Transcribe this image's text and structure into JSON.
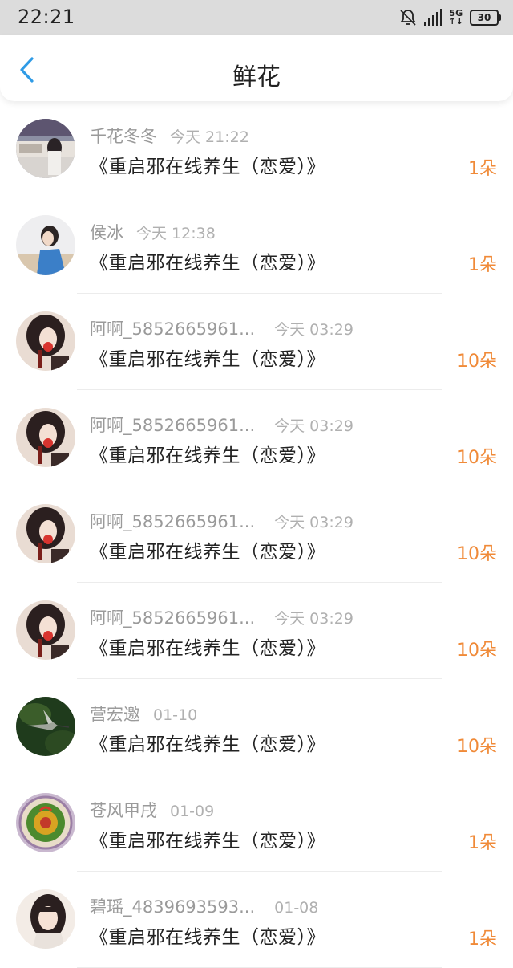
{
  "status_bar": {
    "time": "22:21",
    "network": "5G",
    "battery": "30"
  },
  "header": {
    "title": "鲜花",
    "back_icon": "chevron-left-icon"
  },
  "colors": {
    "accent": "#2f9be6",
    "count": "#f08a38"
  },
  "items": [
    {
      "name": "千花冬冬",
      "date": "今天 21:22",
      "book": "《重启邪在线养生（恋爱）》",
      "count": "1朵"
    },
    {
      "name": "侯冰",
      "date": "今天 12:38",
      "book": "《重启邪在线养生（恋爱）》",
      "count": "1朵"
    },
    {
      "name": "阿啊_5852665961...",
      "date": "今天 03:29",
      "book": "《重启邪在线养生（恋爱）》",
      "count": "10朵"
    },
    {
      "name": "阿啊_5852665961...",
      "date": "今天 03:29",
      "book": "《重启邪在线养生（恋爱）》",
      "count": "10朵"
    },
    {
      "name": "阿啊_5852665961...",
      "date": "今天 03:29",
      "book": "《重启邪在线养生（恋爱）》",
      "count": "10朵"
    },
    {
      "name": "阿啊_5852665961...",
      "date": "今天 03:29",
      "book": "《重启邪在线养生（恋爱）》",
      "count": "10朵"
    },
    {
      "name": "营宏邀",
      "date": "01-10",
      "book": "《重启邪在线养生（恋爱）》",
      "count": "10朵"
    },
    {
      "name": "苍风甲戌",
      "date": "01-09",
      "book": "《重启邪在线养生（恋爱）》",
      "count": "1朵"
    },
    {
      "name": "碧瑶_4839693593...",
      "date": "01-08",
      "book": "《重启邪在线养生（恋爱）》",
      "count": "1朵"
    }
  ]
}
